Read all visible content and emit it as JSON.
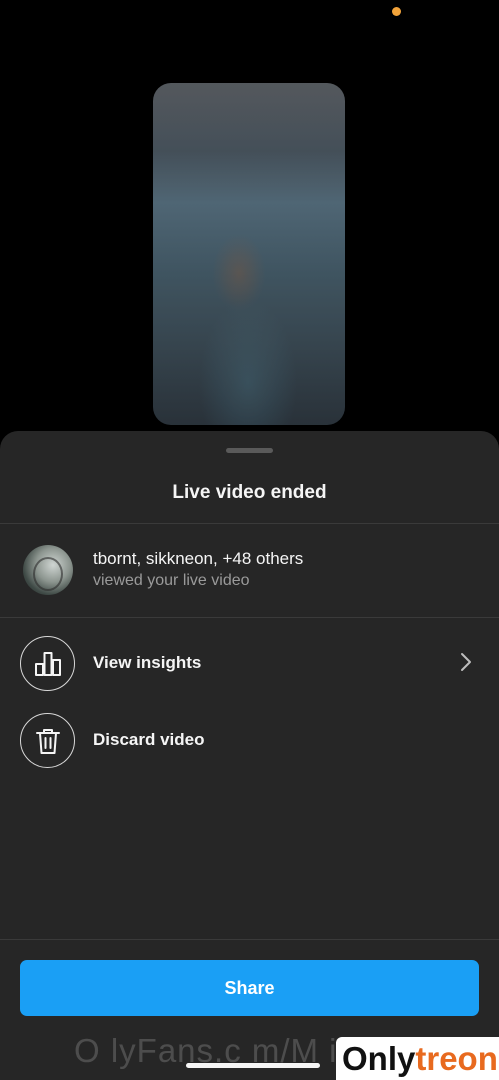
{
  "sheet": {
    "title": "Live video ended"
  },
  "viewers": {
    "names": "tbornt, sikkneon, +48 others",
    "subtitle": "viewed your live video"
  },
  "actions": [
    {
      "label": "View insights",
      "icon": "bar-chart-icon"
    },
    {
      "label": "Discard video",
      "icon": "trash-icon"
    }
  ],
  "share_label": "Share",
  "watermark_text": "O lyFans.c m/M iH",
  "brand": {
    "part1": "Only",
    "part2": "treon"
  },
  "colors": {
    "accent": "#1a9ff5",
    "sheet": "#262626",
    "status_dot": "#f2a33a",
    "brand_orange": "#e86a1f"
  }
}
